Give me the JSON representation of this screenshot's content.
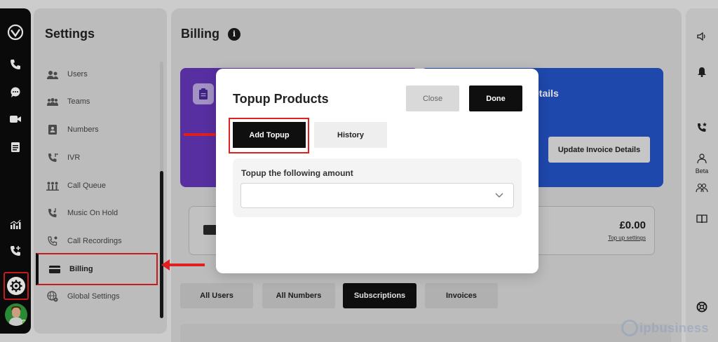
{
  "settings_panel": {
    "title": "Settings",
    "items": [
      {
        "label": "Users",
        "icon": "users-icon"
      },
      {
        "label": "Teams",
        "icon": "teams-icon"
      },
      {
        "label": "Numbers",
        "icon": "numbers-icon"
      },
      {
        "label": "IVR",
        "icon": "ivr-icon"
      },
      {
        "label": "Call Queue",
        "icon": "call-queue-icon"
      },
      {
        "label": "Music On Hold",
        "icon": "music-on-hold-icon"
      },
      {
        "label": "Call Recordings",
        "icon": "call-recordings-icon"
      },
      {
        "label": "Billing",
        "icon": "card-icon",
        "active": true
      },
      {
        "label": "Global Settings",
        "icon": "globe-gear-icon"
      }
    ]
  },
  "billing": {
    "title": "Billing",
    "invoice_card_title": "etails",
    "update_invoice_button": "Update Invoice Details",
    "balance_amount": "£0.00",
    "top_up_link": "Top up settings",
    "tabs": [
      {
        "label": "All Users",
        "active": false
      },
      {
        "label": "All Numbers",
        "active": false
      },
      {
        "label": "Subscriptions",
        "active": true
      },
      {
        "label": "Invoices",
        "active": false
      }
    ]
  },
  "right_rail": {
    "beta_label": "Beta"
  },
  "modal": {
    "title": "Topup Products",
    "close_label": "Close",
    "done_label": "Done",
    "tabs": [
      {
        "label": "Add Topup",
        "active": true
      },
      {
        "label": "History",
        "active": false
      }
    ],
    "amount_label": "Topup the following amount",
    "amount_value": ""
  },
  "watermark": {
    "text": "ipbusiness"
  },
  "colors": {
    "accent_purple": "#6336b8",
    "accent_blue": "#2353c4",
    "highlight_red": "#e02020",
    "primary_black": "#0f0f0f"
  }
}
